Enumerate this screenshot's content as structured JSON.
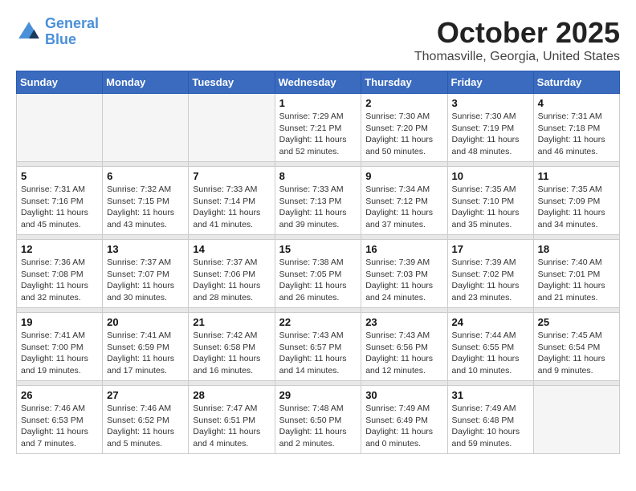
{
  "app": {
    "logo_line1": "General",
    "logo_line2": "Blue"
  },
  "header": {
    "title": "October 2025",
    "subtitle": "Thomasville, Georgia, United States"
  },
  "weekdays": [
    "Sunday",
    "Monday",
    "Tuesday",
    "Wednesday",
    "Thursday",
    "Friday",
    "Saturday"
  ],
  "weeks": [
    [
      {
        "day": "",
        "info": ""
      },
      {
        "day": "",
        "info": ""
      },
      {
        "day": "",
        "info": ""
      },
      {
        "day": "1",
        "info": "Sunrise: 7:29 AM\nSunset: 7:21 PM\nDaylight: 11 hours\nand 52 minutes."
      },
      {
        "day": "2",
        "info": "Sunrise: 7:30 AM\nSunset: 7:20 PM\nDaylight: 11 hours\nand 50 minutes."
      },
      {
        "day": "3",
        "info": "Sunrise: 7:30 AM\nSunset: 7:19 PM\nDaylight: 11 hours\nand 48 minutes."
      },
      {
        "day": "4",
        "info": "Sunrise: 7:31 AM\nSunset: 7:18 PM\nDaylight: 11 hours\nand 46 minutes."
      }
    ],
    [
      {
        "day": "5",
        "info": "Sunrise: 7:31 AM\nSunset: 7:16 PM\nDaylight: 11 hours\nand 45 minutes."
      },
      {
        "day": "6",
        "info": "Sunrise: 7:32 AM\nSunset: 7:15 PM\nDaylight: 11 hours\nand 43 minutes."
      },
      {
        "day": "7",
        "info": "Sunrise: 7:33 AM\nSunset: 7:14 PM\nDaylight: 11 hours\nand 41 minutes."
      },
      {
        "day": "8",
        "info": "Sunrise: 7:33 AM\nSunset: 7:13 PM\nDaylight: 11 hours\nand 39 minutes."
      },
      {
        "day": "9",
        "info": "Sunrise: 7:34 AM\nSunset: 7:12 PM\nDaylight: 11 hours\nand 37 minutes."
      },
      {
        "day": "10",
        "info": "Sunrise: 7:35 AM\nSunset: 7:10 PM\nDaylight: 11 hours\nand 35 minutes."
      },
      {
        "day": "11",
        "info": "Sunrise: 7:35 AM\nSunset: 7:09 PM\nDaylight: 11 hours\nand 34 minutes."
      }
    ],
    [
      {
        "day": "12",
        "info": "Sunrise: 7:36 AM\nSunset: 7:08 PM\nDaylight: 11 hours\nand 32 minutes."
      },
      {
        "day": "13",
        "info": "Sunrise: 7:37 AM\nSunset: 7:07 PM\nDaylight: 11 hours\nand 30 minutes."
      },
      {
        "day": "14",
        "info": "Sunrise: 7:37 AM\nSunset: 7:06 PM\nDaylight: 11 hours\nand 28 minutes."
      },
      {
        "day": "15",
        "info": "Sunrise: 7:38 AM\nSunset: 7:05 PM\nDaylight: 11 hours\nand 26 minutes."
      },
      {
        "day": "16",
        "info": "Sunrise: 7:39 AM\nSunset: 7:03 PM\nDaylight: 11 hours\nand 24 minutes."
      },
      {
        "day": "17",
        "info": "Sunrise: 7:39 AM\nSunset: 7:02 PM\nDaylight: 11 hours\nand 23 minutes."
      },
      {
        "day": "18",
        "info": "Sunrise: 7:40 AM\nSunset: 7:01 PM\nDaylight: 11 hours\nand 21 minutes."
      }
    ],
    [
      {
        "day": "19",
        "info": "Sunrise: 7:41 AM\nSunset: 7:00 PM\nDaylight: 11 hours\nand 19 minutes."
      },
      {
        "day": "20",
        "info": "Sunrise: 7:41 AM\nSunset: 6:59 PM\nDaylight: 11 hours\nand 17 minutes."
      },
      {
        "day": "21",
        "info": "Sunrise: 7:42 AM\nSunset: 6:58 PM\nDaylight: 11 hours\nand 16 minutes."
      },
      {
        "day": "22",
        "info": "Sunrise: 7:43 AM\nSunset: 6:57 PM\nDaylight: 11 hours\nand 14 minutes."
      },
      {
        "day": "23",
        "info": "Sunrise: 7:43 AM\nSunset: 6:56 PM\nDaylight: 11 hours\nand 12 minutes."
      },
      {
        "day": "24",
        "info": "Sunrise: 7:44 AM\nSunset: 6:55 PM\nDaylight: 11 hours\nand 10 minutes."
      },
      {
        "day": "25",
        "info": "Sunrise: 7:45 AM\nSunset: 6:54 PM\nDaylight: 11 hours\nand 9 minutes."
      }
    ],
    [
      {
        "day": "26",
        "info": "Sunrise: 7:46 AM\nSunset: 6:53 PM\nDaylight: 11 hours\nand 7 minutes."
      },
      {
        "day": "27",
        "info": "Sunrise: 7:46 AM\nSunset: 6:52 PM\nDaylight: 11 hours\nand 5 minutes."
      },
      {
        "day": "28",
        "info": "Sunrise: 7:47 AM\nSunset: 6:51 PM\nDaylight: 11 hours\nand 4 minutes."
      },
      {
        "day": "29",
        "info": "Sunrise: 7:48 AM\nSunset: 6:50 PM\nDaylight: 11 hours\nand 2 minutes."
      },
      {
        "day": "30",
        "info": "Sunrise: 7:49 AM\nSunset: 6:49 PM\nDaylight: 11 hours\nand 0 minutes."
      },
      {
        "day": "31",
        "info": "Sunrise: 7:49 AM\nSunset: 6:48 PM\nDaylight: 10 hours\nand 59 minutes."
      },
      {
        "day": "",
        "info": ""
      }
    ]
  ]
}
